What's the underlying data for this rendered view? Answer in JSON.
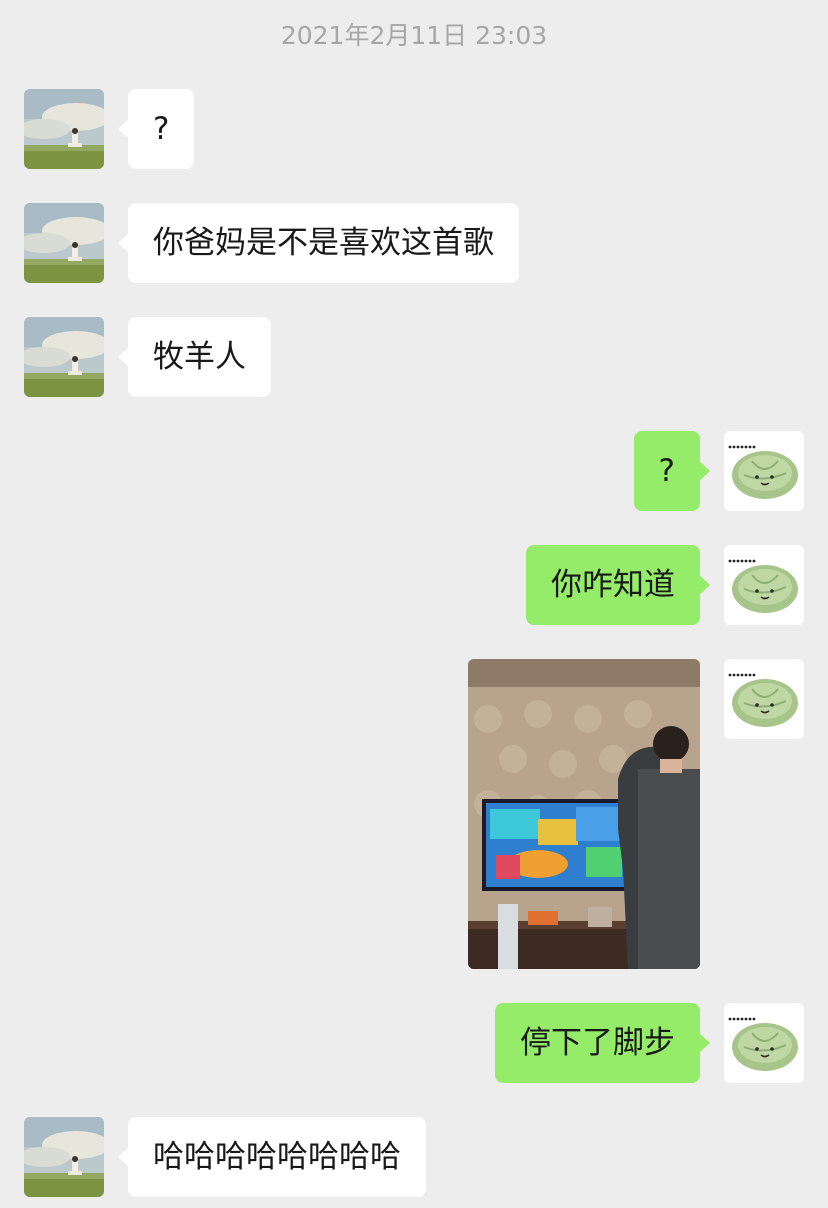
{
  "conversation": {
    "timestamp": "2021年2月11日 23:03",
    "messages": [
      {
        "side": "in",
        "type": "text",
        "text": "?"
      },
      {
        "side": "in",
        "type": "text",
        "text": "你爸妈是不是喜欢这首歌"
      },
      {
        "side": "in",
        "type": "text",
        "text": "牧羊人"
      },
      {
        "side": "out",
        "type": "text",
        "text": "?"
      },
      {
        "side": "out",
        "type": "text",
        "text": "你咋知道"
      },
      {
        "side": "out",
        "type": "image",
        "icon": "photo-living-room-tv"
      },
      {
        "side": "out",
        "type": "text",
        "text": "停下了脚步"
      },
      {
        "side": "in",
        "type": "text",
        "text": "哈哈哈哈哈哈哈哈"
      }
    ]
  },
  "avatars": {
    "contact": "landscape-avatar-icon",
    "self": "cabbage-avatar-icon"
  },
  "colors": {
    "background": "#ededed",
    "incoming_bubble": "#ffffff",
    "outgoing_bubble": "#95ec69",
    "timestamp_text": "#a6a6a6"
  }
}
